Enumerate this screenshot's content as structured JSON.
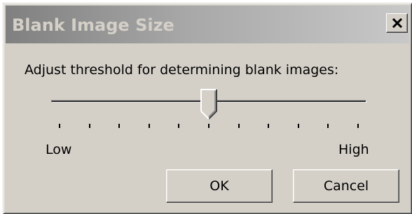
{
  "dialog": {
    "title": "Blank Image Size",
    "close_icon": "close-icon"
  },
  "prompt": "Adjust threshold for determining blank images:",
  "slider": {
    "min_label": "Low",
    "max_label": "High",
    "tick_count": 11,
    "value_fraction": 0.5
  },
  "buttons": {
    "ok_label": "OK",
    "cancel_label": "Cancel"
  },
  "colors": {
    "face": "#d4d0c8",
    "titlebar_inactive_start": "#808080",
    "titlebar_inactive_end": "#c8c8c8"
  }
}
